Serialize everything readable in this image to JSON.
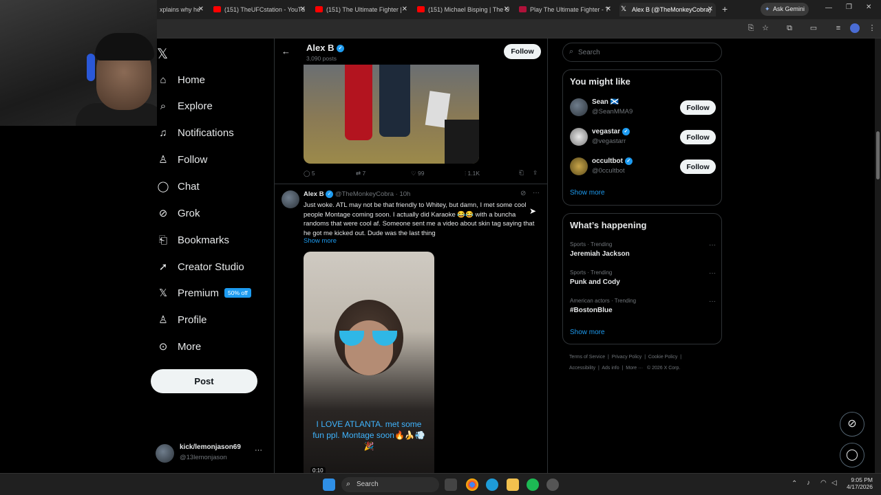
{
  "browser": {
    "tabs": [
      {
        "title": "xplains why he"
      },
      {
        "title": "(151) TheUFCstation - YouTu"
      },
      {
        "title": "(151) The Ultimate Fighter |"
      },
      {
        "title": "(151) Michael Bisping | The U"
      },
      {
        "title": "Play The Ultimate Fighter - T"
      },
      {
        "title": "Alex B (@TheMonkeyCobra)"
      }
    ],
    "new_tab": "+",
    "ask_gemini": "Ask Gemini"
  },
  "sidebar": {
    "logo": "𝕏",
    "items": [
      {
        "label": "Home",
        "icon": "home-icon"
      },
      {
        "label": "Explore",
        "icon": "search-icon"
      },
      {
        "label": "Notifications",
        "icon": "bell-icon"
      },
      {
        "label": "Follow",
        "icon": "person-add-icon"
      },
      {
        "label": "Chat",
        "icon": "chat-icon"
      },
      {
        "label": "Grok",
        "icon": "grok-icon"
      },
      {
        "label": "Bookmarks",
        "icon": "bookmark-icon"
      },
      {
        "label": "Creator Studio",
        "icon": "rocket-icon"
      },
      {
        "label": "Premium",
        "icon": "x-icon",
        "badge": "50% off"
      },
      {
        "label": "Profile",
        "icon": "person-icon"
      },
      {
        "label": "More",
        "icon": "more-circle-icon"
      }
    ],
    "post_button": "Post",
    "user": {
      "name": "kick/lemonjason69",
      "handle": "@13lemonjason",
      "more": "···"
    }
  },
  "profile_header": {
    "name": "Alex B",
    "posts_count": "3,090 posts",
    "follow": "Follow"
  },
  "first_post": {
    "replies": "5",
    "reposts": "7",
    "likes": "99",
    "views": "1.1K"
  },
  "second_post": {
    "author_name": "Alex B",
    "handle": "@TheMonkeyCobra",
    "separator": "·",
    "time": "10h",
    "text": "Just woke.  ATL may not be that friendly to Whitey, but damn, I met some cool people  Montage coming soon.  I actually did Karaoke 😂😂 with a buncha randoms that were cool af. Someone sent me a video about skin tag saying that he got me kicked out.   Dude was the last thing",
    "show_more": "Show more",
    "video_caption": "I LOVE ATLANTA. met some fun ppl. Montage soon🔥🍌💨🎉",
    "video_time": "0:10"
  },
  "right": {
    "search_placeholder": "Search",
    "you_might_like": {
      "title": "You might like",
      "users": [
        {
          "name": "Sean 🏴󠁧󠁢󠁳󠁣󠁴󠁿",
          "handle": "@SeanMMA9",
          "follow": "Follow",
          "verified": false
        },
        {
          "name": "vegastar",
          "handle": "@vegastarr",
          "follow": "Follow",
          "verified": true
        },
        {
          "name": "occultbot",
          "handle": "@0ccultbot",
          "follow": "Follow",
          "verified": true
        }
      ],
      "show_more": "Show more"
    },
    "whats_happening": {
      "title": "What’s happening",
      "trends": [
        {
          "meta": "Sports · Trending",
          "topic": "Jeremiah Jackson"
        },
        {
          "meta": "Sports · Trending",
          "topic": "Punk and Cody"
        },
        {
          "meta": "American actors · Trending",
          "topic": "#BostonBlue"
        }
      ],
      "show_more": "Show more"
    },
    "footer": {
      "row1": [
        "Terms of Service",
        "Privacy Policy",
        "Cookie Policy"
      ],
      "row2": [
        "Accessibility",
        "Ads info",
        "More ···",
        "© 2026 X Corp."
      ]
    }
  },
  "taskbar": {
    "search": "Search",
    "time": "9:05 PM",
    "date": "4/17/2026"
  },
  "colors": {
    "accent": "#1d9bf0",
    "background": "#000000",
    "border": "#2f3336",
    "muted": "#71767b"
  }
}
